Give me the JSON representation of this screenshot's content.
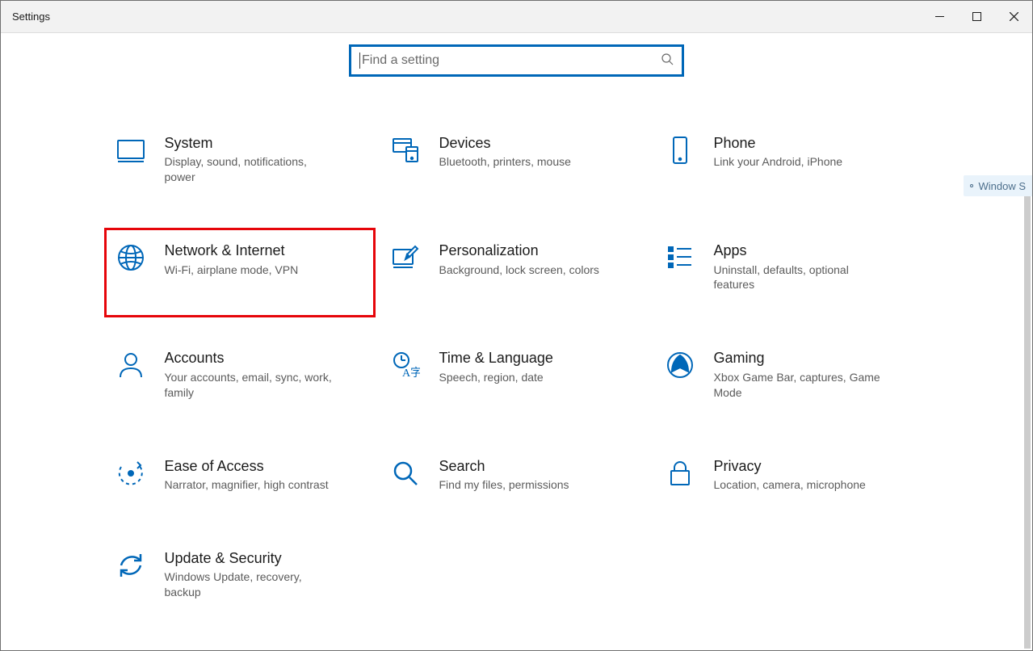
{
  "window": {
    "title": "Settings"
  },
  "search": {
    "placeholder": "Find a setting"
  },
  "tag": "Window S",
  "categories": [
    {
      "key": "system",
      "title": "System",
      "desc": "Display, sound, notifications, power"
    },
    {
      "key": "devices",
      "title": "Devices",
      "desc": "Bluetooth, printers, mouse"
    },
    {
      "key": "phone",
      "title": "Phone",
      "desc": "Link your Android, iPhone"
    },
    {
      "key": "network",
      "title": "Network & Internet",
      "desc": "Wi-Fi, airplane mode, VPN",
      "highlight": true
    },
    {
      "key": "personalization",
      "title": "Personalization",
      "desc": "Background, lock screen, colors"
    },
    {
      "key": "apps",
      "title": "Apps",
      "desc": "Uninstall, defaults, optional features"
    },
    {
      "key": "accounts",
      "title": "Accounts",
      "desc": "Your accounts, email, sync, work, family"
    },
    {
      "key": "time",
      "title": "Time & Language",
      "desc": "Speech, region, date"
    },
    {
      "key": "gaming",
      "title": "Gaming",
      "desc": "Xbox Game Bar, captures, Game Mode"
    },
    {
      "key": "ease",
      "title": "Ease of Access",
      "desc": "Narrator, magnifier, high contrast"
    },
    {
      "key": "search",
      "title": "Search",
      "desc": "Find my files, permissions"
    },
    {
      "key": "privacy",
      "title": "Privacy",
      "desc": "Location, camera, microphone"
    },
    {
      "key": "update",
      "title": "Update & Security",
      "desc": "Windows Update, recovery, backup"
    }
  ]
}
